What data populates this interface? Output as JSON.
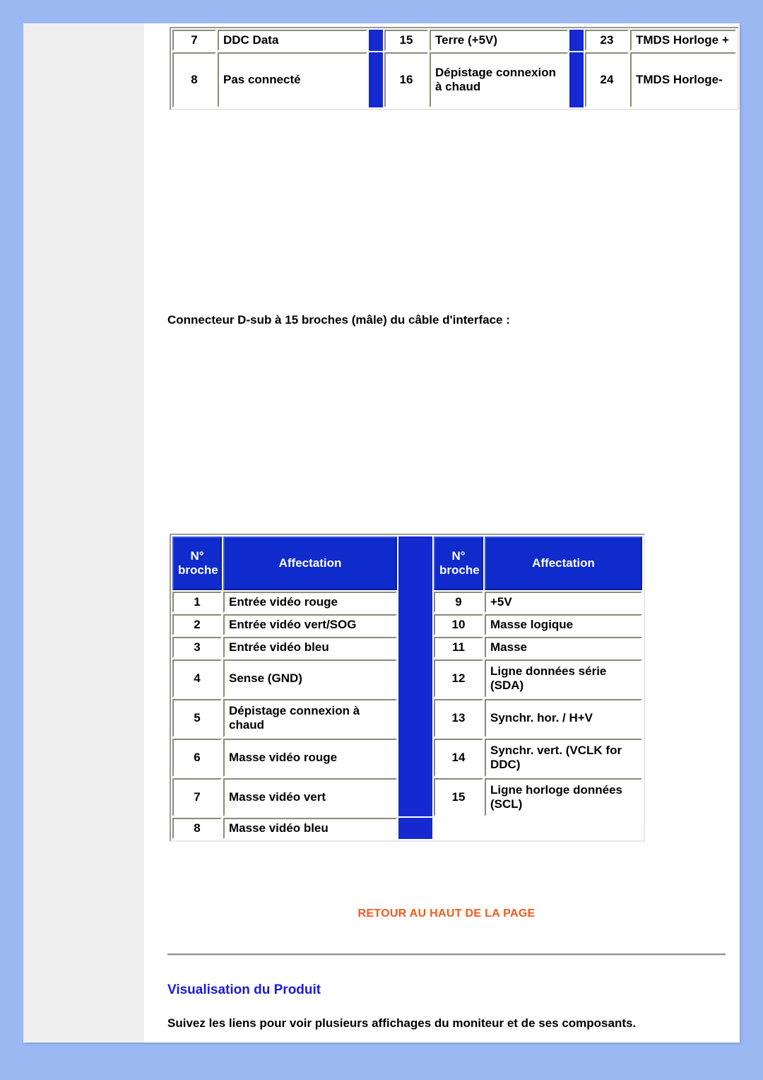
{
  "top_table": {
    "rows": [
      {
        "left_num": "7",
        "left_label": "DDC Data",
        "mid_num": "15",
        "mid_label": "Terre (+5V)",
        "right_num": "23",
        "right_label": "TMDS Horloge +"
      },
      {
        "left_num": "8",
        "left_label": "Pas connecté",
        "mid_num": "16",
        "mid_label": "Dépistage connexion à chaud",
        "right_num": "24",
        "right_label": "TMDS Horloge-"
      }
    ]
  },
  "dsub_caption": "Connecteur D-sub à 15 broches (mâle) du câble d'interface :",
  "main_table": {
    "headers": {
      "pin": "N° broche",
      "pin_line1": "N°",
      "pin_line2": "broche",
      "assignment": "Affectation"
    },
    "left_rows": [
      {
        "num": "1",
        "label": "Entrée vidéo rouge"
      },
      {
        "num": "2",
        "label": "Entrée vidéo vert/SOG"
      },
      {
        "num": "3",
        "label": "Entrée vidéo bleu"
      },
      {
        "num": "4",
        "label": "Sense (GND)"
      },
      {
        "num": "5",
        "label": "Dépistage connexion à chaud"
      },
      {
        "num": "6",
        "label": "Masse vidéo rouge"
      },
      {
        "num": "7",
        "label": "Masse vidéo vert"
      },
      {
        "num": "8",
        "label": "Masse vidéo bleu"
      }
    ],
    "right_rows": [
      {
        "num": "9",
        "label": "+5V"
      },
      {
        "num": "10",
        "label": "Masse logique"
      },
      {
        "num": "11",
        "label": "Masse"
      },
      {
        "num": "12",
        "label": "Ligne données série (SDA)"
      },
      {
        "num": "13",
        "label": "Synchr. hor. / H+V"
      },
      {
        "num": "14",
        "label": "Synchr. vert. (VCLK for DDC)"
      },
      {
        "num": "15",
        "label": "Ligne horloge données (SCL)"
      }
    ]
  },
  "footer": {
    "back_to_top": "RETOUR AU HAUT DE LA PAGE",
    "section_heading": "Visualisation du Produit",
    "follow_links": "Suivez les liens pour voir plusieurs affichages du moniteur et de ses composants."
  },
  "colors": {
    "page_background": "#9bb8f2",
    "rail": "#efefef",
    "table_blue": "#0f2bcc",
    "separator_blue": "#1429cf",
    "link_orange": "#f4591b",
    "heading_blue": "#1a1ae0"
  }
}
